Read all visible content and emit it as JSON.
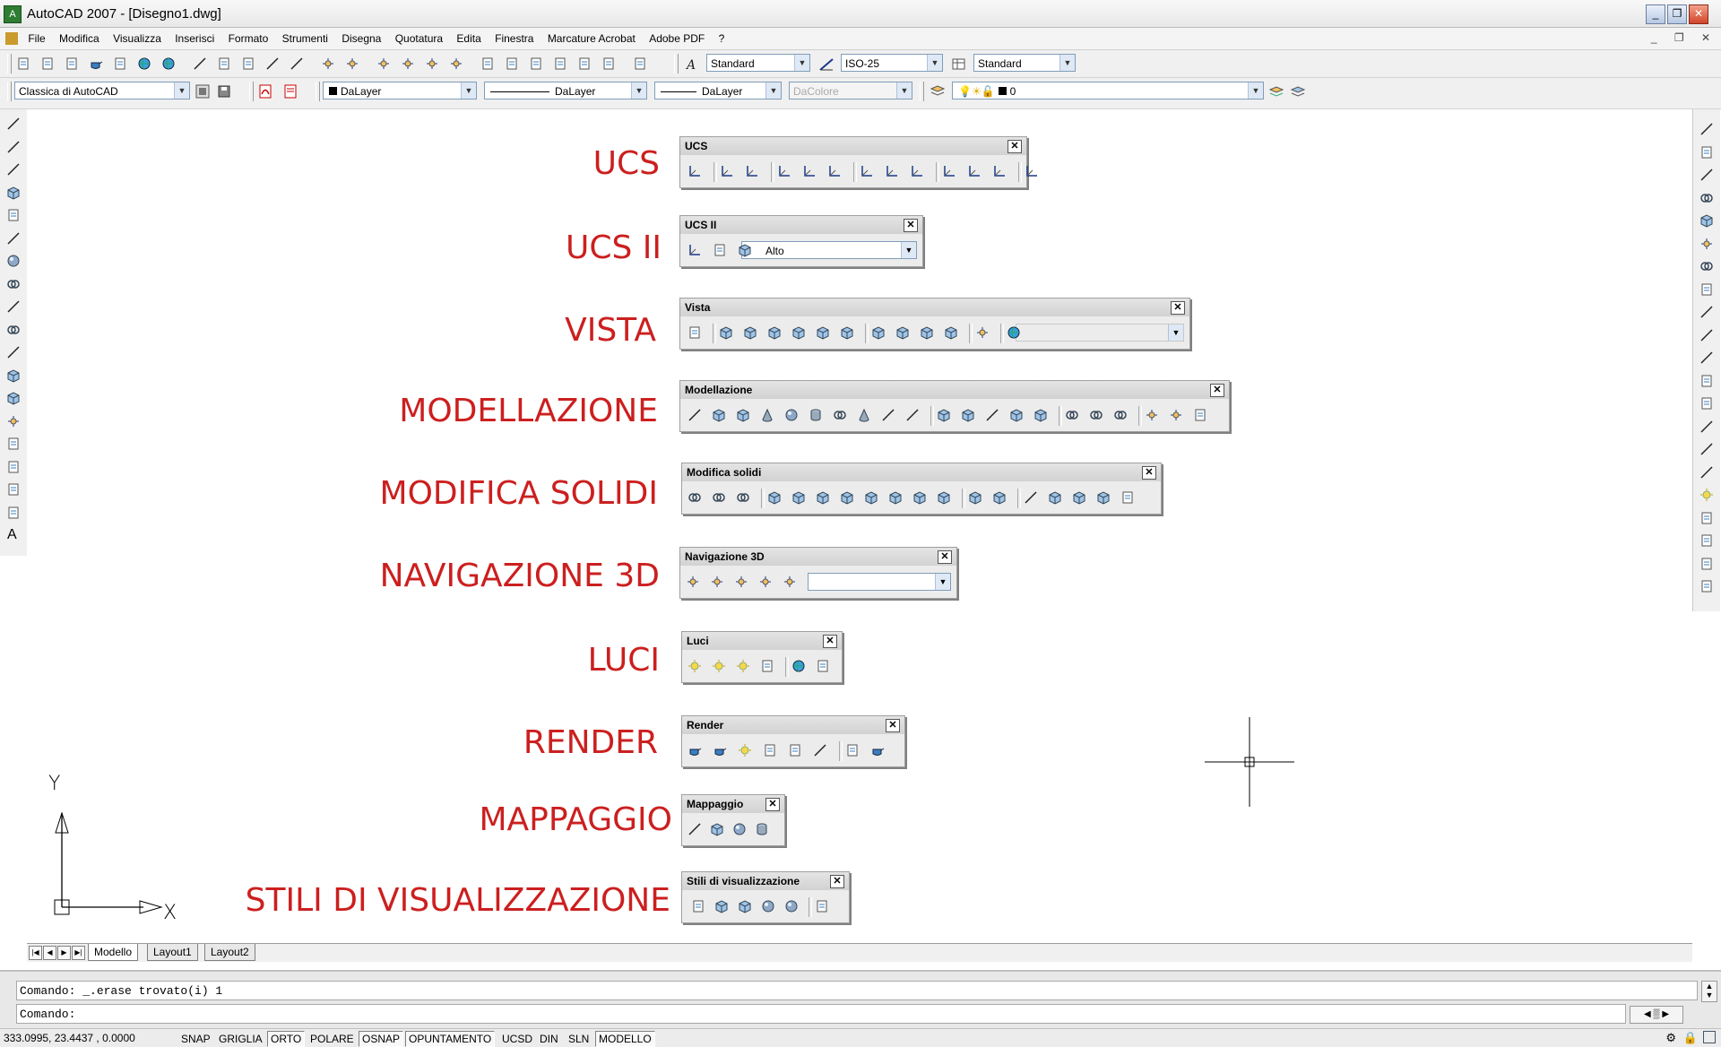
{
  "window": {
    "title": "AutoCAD 2007 - [Disegno1.dwg]"
  },
  "menu": [
    "File",
    "Modifica",
    "Visualizza",
    "Inserisci",
    "Formato",
    "Strumenti",
    "Disegna",
    "Quotatura",
    "Edita",
    "Finestra",
    "Marcature Acrobat",
    "Adobe PDF",
    "?"
  ],
  "toolbar1": {
    "textstyle": "Standard",
    "dimstyle": "ISO-25",
    "tablestyle": "Standard"
  },
  "toolbar2": {
    "workspace": "Classica di AutoCAD",
    "layer_color": "DaLayer",
    "linetype": "DaLayer",
    "lineweight": "DaLayer",
    "plotstyle": "DaColore",
    "layer": "0"
  },
  "captions": [
    "UCS",
    "UCS II",
    "VISTA",
    "MODELLAZIONE",
    "MODIFICA SOLIDI",
    "NAVIGAZIONE 3D",
    "LUCI",
    "RENDER",
    "MAPPAGGIO",
    "STILI DI VISUALIZZAZIONE"
  ],
  "palettes": {
    "ucs": "UCS",
    "ucs2": "UCS II",
    "ucs2_combo": "Alto",
    "vista": "Vista",
    "modellazione": "Modellazione",
    "modifica": "Modifica solidi",
    "nav3d": "Navigazione 3D",
    "luci": "Luci",
    "render": "Render",
    "mappaggio": "Mappaggio",
    "stili": "Stili di visualizzazione"
  },
  "ucs_axes": {
    "x": "X",
    "y": "Y"
  },
  "left_tool_letter": "A",
  "tabs": [
    "Modello",
    "Layout1",
    "Layout2"
  ],
  "command": {
    "history": "Comando:  _.erase trovato(i) 1",
    "prompt": "Comando:"
  },
  "status": {
    "coords": "333.0995, 23.4437 , 0.0000",
    "buttons": [
      "SNAP",
      "GRIGLIA",
      "ORTO",
      "POLARE",
      "OSNAP",
      "OPUNTAMENTO",
      "UCSD",
      "DIN",
      "SLN",
      "MODELLO"
    ]
  },
  "colors": {
    "caption": "#cc1f1f",
    "accent_close": "#d2452a"
  }
}
